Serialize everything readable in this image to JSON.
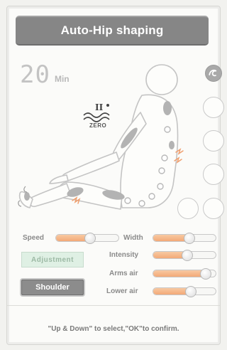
{
  "title": "Auto-Hip shaping",
  "timer": {
    "value": "20",
    "unit": "Min"
  },
  "mode_icon": {
    "name": "zero-gravity-icon",
    "numeral": "II",
    "label": "ZERO"
  },
  "status_circles": [
    {
      "name": "wave-mode-icon",
      "active": true
    },
    {
      "name": "empty-indicator",
      "active": false
    },
    {
      "name": "empty-indicator",
      "active": false
    },
    {
      "name": "empty-indicator",
      "active": false
    },
    {
      "name": "empty-indicator",
      "active": false
    },
    {
      "name": "empty-indicator",
      "active": false
    }
  ],
  "sliders": {
    "speed": {
      "label": "Speed",
      "level": 0.55
    },
    "width": {
      "label": "Width",
      "level": 0.6
    },
    "intensity": {
      "label": "Intensity",
      "level": 0.55
    },
    "arms_air": {
      "label": "Arms air",
      "level": 0.92
    },
    "lower_air": {
      "label": "Lower air",
      "level": 0.62
    }
  },
  "buttons": {
    "adjustment": "Adjustment",
    "shoulder": "Shoulder"
  },
  "footer": "\"Up & Down\" to select,\"OK\"to confirm.",
  "colors": {
    "accent": "#f3a977",
    "title_bar": "#868686",
    "body_outline": "#c8c8c8",
    "active_zone": "#aeaeae"
  }
}
